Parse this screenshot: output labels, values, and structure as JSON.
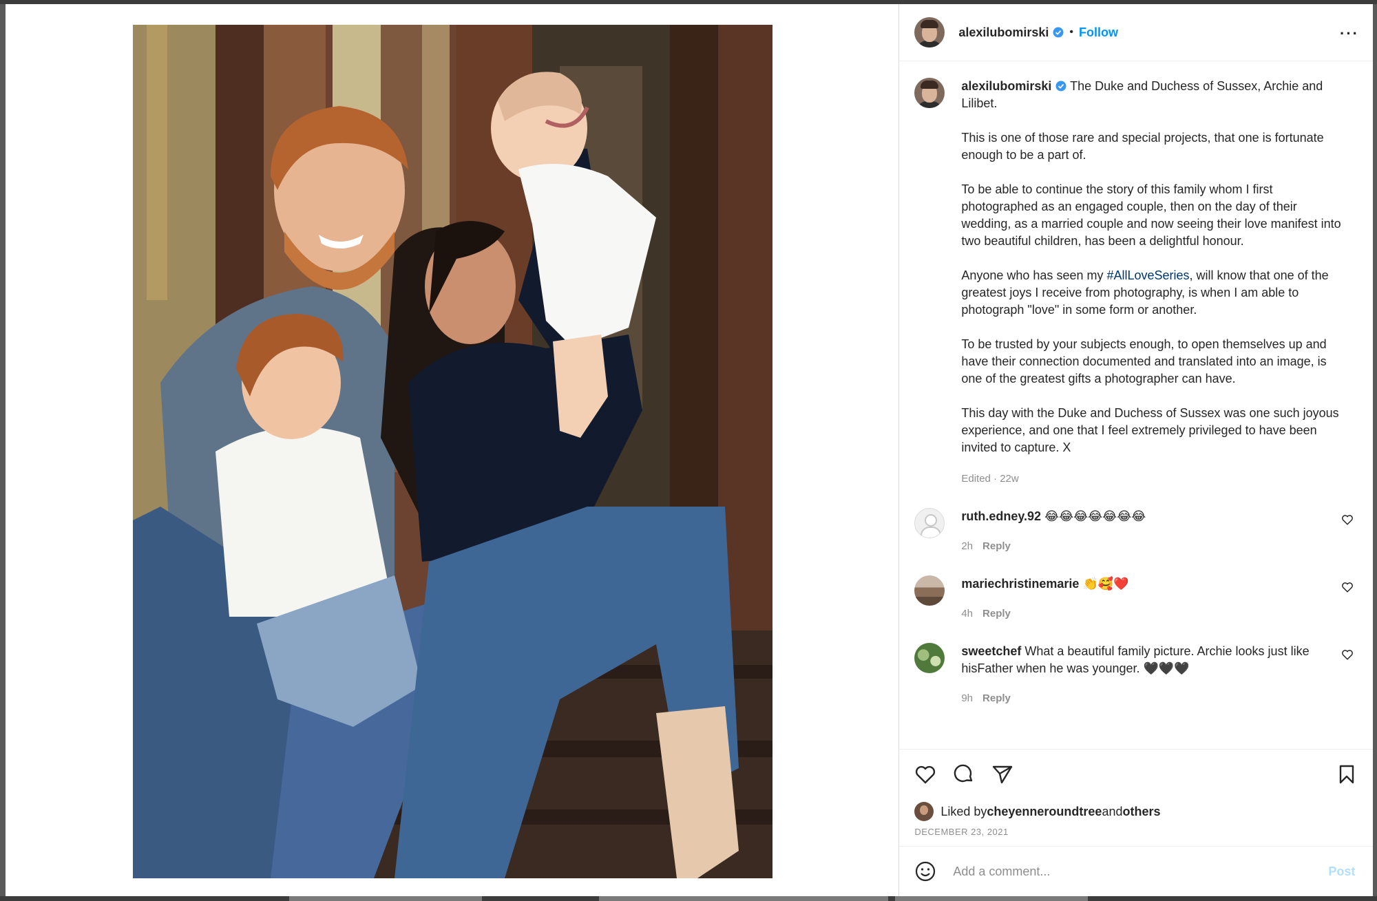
{
  "post": {
    "author": "alexilubomirski",
    "follow_label": "Follow",
    "separator": "•",
    "more_label": "···",
    "caption_intro": " The Duke and Duchess of Sussex, Archie and Lilibet.",
    "paragraphs": [
      "This is one of those rare and special projects, that one is fortunate enough to be a part of.",
      "To be able to continue the story of this family whom I first photographed as an engaged couple, then on the day of their wedding, as a married couple and now seeing their love manifest into two beautiful children, has been a delightful honour."
    ],
    "para3_before": "Anyone who has seen my ",
    "para3_hashtag": "#AllLoveSeries",
    "para3_after": ", will know that one of the greatest joys I receive from photography, is when I am able to photograph \"love\" in some form or another.",
    "para4": "To be trusted by your subjects enough, to open themselves up and have their connection documented and translated into an image, is one of the greatest gifts a photographer can have.",
    "para5": "This day with the Duke and Duchess of Sussex was one such joyous experience, and one that I feel extremely privileged to have been invited to capture. X",
    "edited_meta": "Edited · 22w",
    "date": "DECEMBER 23, 2021"
  },
  "comments": [
    {
      "user": "ruth.edney.92",
      "text": " 😂😂😂😂😂😂😂",
      "time": "2h",
      "reply": "Reply"
    },
    {
      "user": "mariechristinemarie",
      "text": " 👏🥰❤️",
      "time": "4h",
      "reply": "Reply"
    },
    {
      "user": "sweetchef",
      "text": " What a beautiful family picture. Archie looks just like hisFather when he was younger. 🖤🖤🖤",
      "time": "9h",
      "reply": "Reply"
    }
  ],
  "likes": {
    "prefix": "Liked by ",
    "user": "cheyenneroundtree",
    "and": " and ",
    "others": "others"
  },
  "composer": {
    "placeholder": "Add a comment...",
    "post_label": "Post"
  },
  "icons": {
    "verified": "verified-badge-icon",
    "like": "heart-icon",
    "comment": "comment-icon",
    "share": "paper-plane-icon",
    "save": "bookmark-icon",
    "emoji": "emoji-icon",
    "more": "more-options-icon"
  },
  "colors": {
    "accent": "#0095f6",
    "hashtag": "#00376b",
    "muted": "#8e8e8e",
    "post_disabled": "#b2dffc"
  }
}
